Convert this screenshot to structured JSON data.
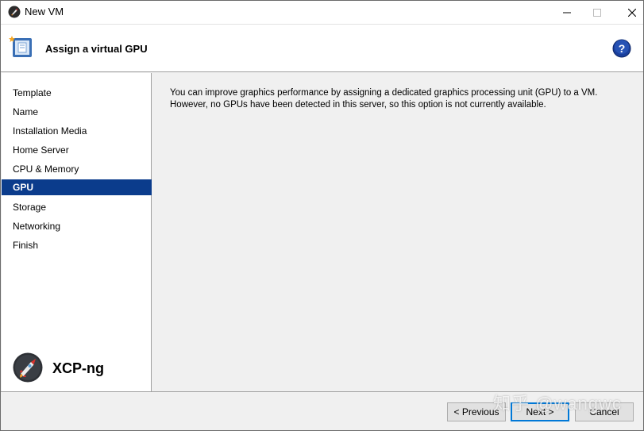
{
  "window": {
    "title": "New VM"
  },
  "header": {
    "heading": "Assign a virtual GPU"
  },
  "sidebar": {
    "steps": [
      {
        "label": "Template"
      },
      {
        "label": "Name"
      },
      {
        "label": "Installation Media"
      },
      {
        "label": "Home Server"
      },
      {
        "label": "CPU & Memory"
      },
      {
        "label": "GPU",
        "active": true
      },
      {
        "label": "Storage"
      },
      {
        "label": "Networking"
      },
      {
        "label": "Finish"
      }
    ],
    "brand": "XCP-ng"
  },
  "main": {
    "info_line1": "You can improve graphics performance by assigning a dedicated graphics processing unit (GPU) to a VM.",
    "info_line2": "However, no GPUs have been detected in this server, so this option is not currently available."
  },
  "footer": {
    "previous_label": "< Previous",
    "next_label": "Next >",
    "cancel_label": "Cancel"
  },
  "watermark": "知乎 @wangwc",
  "colors": {
    "active_step": "#0b3c8c",
    "help_icon": "#1a3f9c"
  }
}
